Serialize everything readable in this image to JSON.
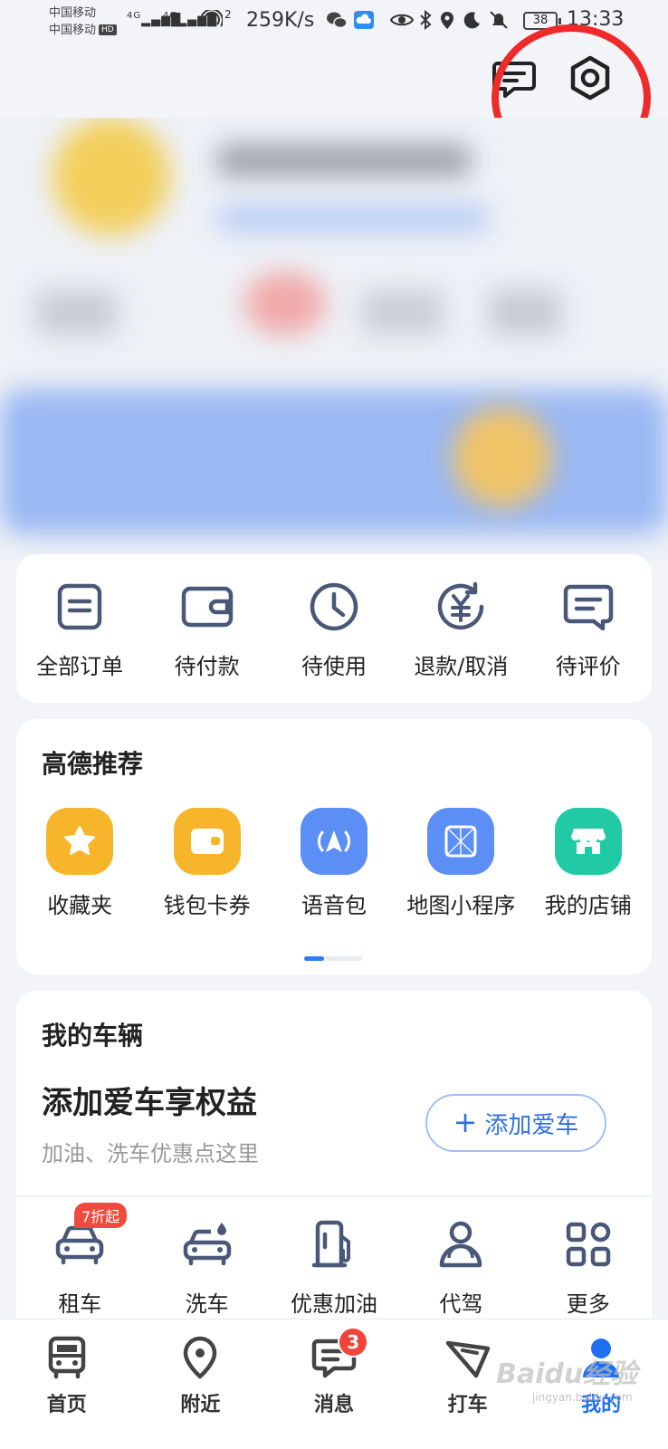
{
  "status_bar": {
    "carrier_1": "中国移动",
    "carrier_2": "中国移动",
    "hd_label": "HD",
    "signal_1": "4G",
    "signal_2": "4G",
    "hotspot_sup": "2",
    "net_speed": "259K/s",
    "battery": "38",
    "time": "13:33"
  },
  "header": {
    "message_icon": "message-icon",
    "settings_icon": "settings-icon"
  },
  "orders": {
    "items": [
      {
        "label": "全部订单",
        "icon": "all-orders-icon"
      },
      {
        "label": "待付款",
        "icon": "wallet-icon"
      },
      {
        "label": "待使用",
        "icon": "clock-icon"
      },
      {
        "label": "退款/取消",
        "icon": "refund-icon"
      },
      {
        "label": "待评价",
        "icon": "review-icon"
      }
    ]
  },
  "recommend": {
    "title": "高德推荐",
    "items": [
      {
        "label": "收藏夹",
        "icon": "star-icon",
        "color": "#f7b52c"
      },
      {
        "label": "钱包卡券",
        "icon": "wallet-card-icon",
        "color": "#f7b52c"
      },
      {
        "label": "语音包",
        "icon": "voice-navigation-icon",
        "color": "#5b8ff5"
      },
      {
        "label": "地图小程序",
        "icon": "mini-program-icon",
        "color": "#5b8ff5"
      },
      {
        "label": "我的店铺",
        "icon": "shop-icon",
        "color": "#22c9a5"
      }
    ]
  },
  "vehicle": {
    "title": "我的车辆",
    "headline": "添加爱车享权益",
    "subtitle": "加油、洗车优惠点这里",
    "add_button": "添加爱车",
    "add_button_plus": "+",
    "services": [
      {
        "label": "租车",
        "icon": "rent-car-icon",
        "badge": "7折起"
      },
      {
        "label": "洗车",
        "icon": "car-wash-icon"
      },
      {
        "label": "优惠加油",
        "icon": "fuel-icon"
      },
      {
        "label": "代驾",
        "icon": "driver-icon"
      },
      {
        "label": "更多",
        "icon": "more-grid-icon"
      }
    ]
  },
  "bottom_nav": {
    "items": [
      {
        "label": "首页",
        "icon": "home-bus-icon"
      },
      {
        "label": "附近",
        "icon": "location-pin-icon"
      },
      {
        "label": "消息",
        "icon": "chat-icon",
        "badge": "3"
      },
      {
        "label": "打车",
        "icon": "taxi-icon"
      },
      {
        "label": "我的",
        "icon": "profile-icon"
      }
    ],
    "active": "我的"
  },
  "watermark": {
    "text": "Baidu经验",
    "url": "jingyan.baidu.com"
  },
  "colors": {
    "accent": "#1f6ff2",
    "highlight_circle": "#ee2a2a",
    "badge": "#f0433a",
    "icon_stroke": "#4a5878"
  }
}
